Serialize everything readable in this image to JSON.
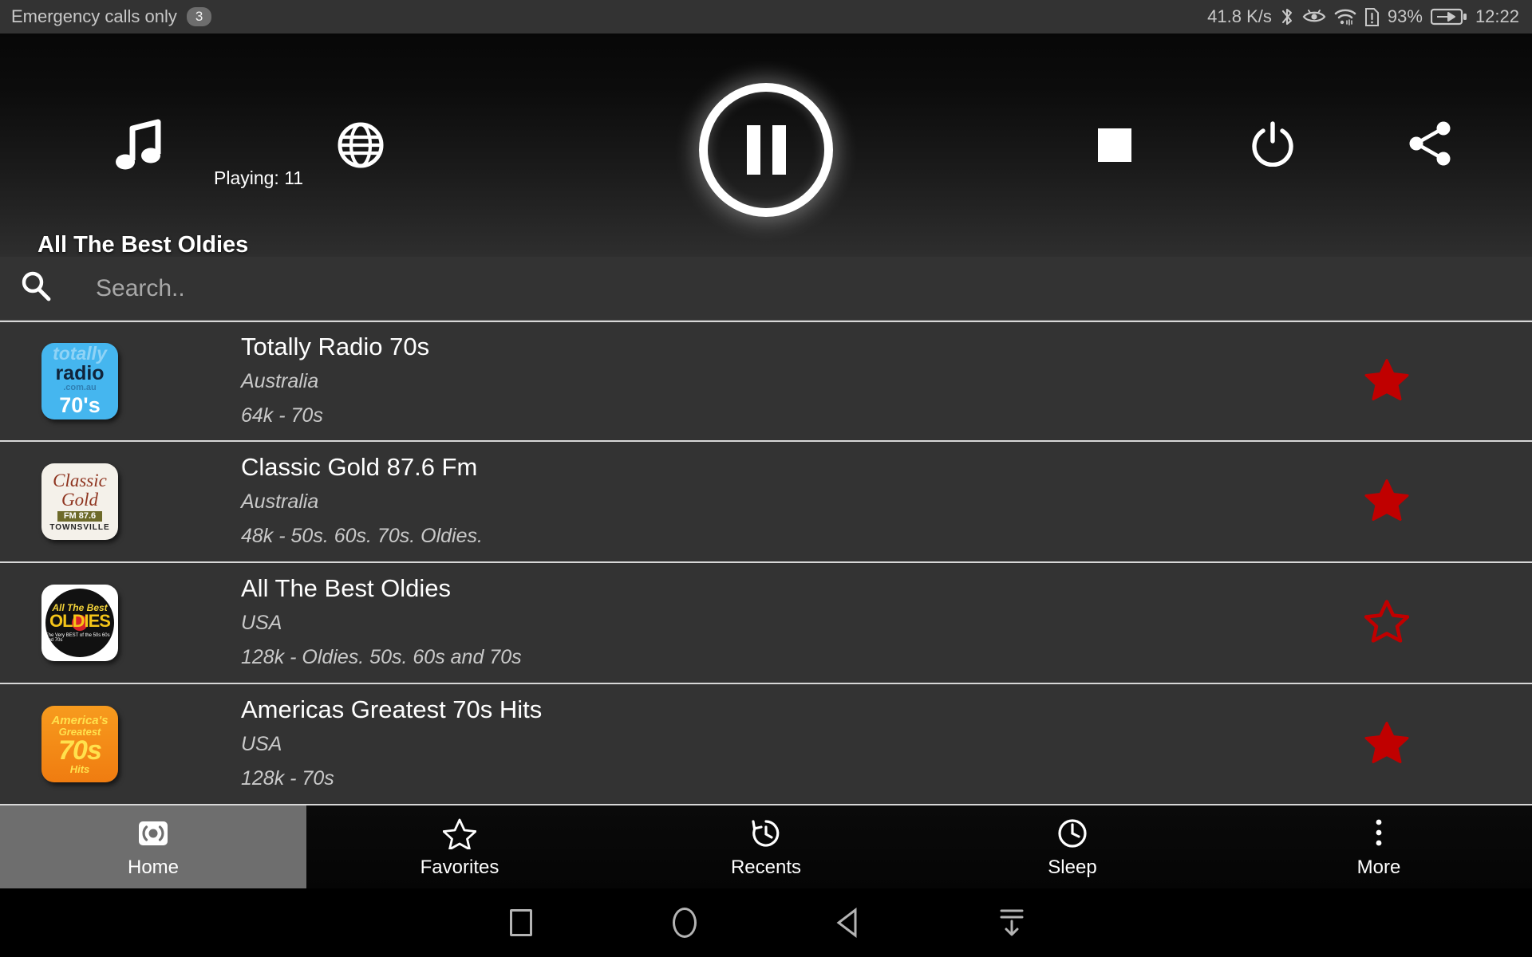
{
  "status_bar": {
    "carrier_text": "Emergency calls only",
    "notification_count": "3",
    "network_speed": "41.8 K/s",
    "bluetooth_icon": "bluetooth-icon",
    "eye_icon": "eye-care-icon",
    "wifi_icon": "wifi-icon",
    "sim_alert_icon": "sim-card-alert-icon",
    "battery_percent": "93%",
    "battery_icon": "battery-charging-icon",
    "clock": "12:22"
  },
  "player": {
    "music_icon": "music-note-icon",
    "globe_icon": "globe-icon",
    "playpause_icon": "pause-icon",
    "stop_icon": "stop-icon",
    "power_icon": "power-icon",
    "share_icon": "share-icon",
    "playing_label": "Playing: 11",
    "now_playing_title": "All The Best Oldies"
  },
  "search": {
    "icon": "search-icon",
    "placeholder": "Search..",
    "value": ""
  },
  "stations": [
    {
      "name": "Totally Radio 70s",
      "country": "Australia",
      "details": "64k - 70s",
      "favorite": true,
      "logo_alt": "totally-radio-70s-logo",
      "logo_lines": [
        "totally",
        "radio",
        ".com.au",
        "70's"
      ]
    },
    {
      "name": "Classic Gold 87.6 Fm",
      "country": "Australia",
      "details": "48k - 50s. 60s. 70s. Oldies.",
      "favorite": true,
      "logo_alt": "classic-gold-logo",
      "logo_lines": [
        "Classic",
        "Gold",
        "FM 87.6",
        "TOWNSVILLE"
      ]
    },
    {
      "name": "All The Best Oldies",
      "country": "USA",
      "details": "128k - Oldies. 50s. 60s and 70s",
      "favorite": false,
      "logo_alt": "all-the-best-oldies-logo",
      "logo_lines": [
        "All The Best",
        "OLDIES",
        "The Very BEST of the 50s 60s and 70s"
      ]
    },
    {
      "name": "Americas Greatest 70s Hits",
      "country": "USA",
      "details": "128k - 70s",
      "favorite": true,
      "logo_alt": "americas-greatest-70s-hits-logo",
      "logo_lines": [
        "America's",
        "Greatest",
        "70s",
        "Hits"
      ]
    }
  ],
  "bottom_nav": {
    "active_index": 0,
    "items": [
      {
        "label": "Home",
        "icon": "broadcast-icon"
      },
      {
        "label": "Favorites",
        "icon": "star-outline-icon"
      },
      {
        "label": "Recents",
        "icon": "history-icon"
      },
      {
        "label": "Sleep",
        "icon": "clock-icon"
      },
      {
        "label": "More",
        "icon": "overflow-menu-icon"
      }
    ]
  },
  "android_nav": {
    "recents_icon": "square-recents-icon",
    "home_icon": "circle-home-icon",
    "back_icon": "triangle-back-icon",
    "hide_icon": "hide-navbar-icon"
  },
  "colors": {
    "favorite_star": "#c00000",
    "list_bg": "#333333",
    "divider": "#d8d8d8",
    "active_nav": "#6e6e6e"
  }
}
